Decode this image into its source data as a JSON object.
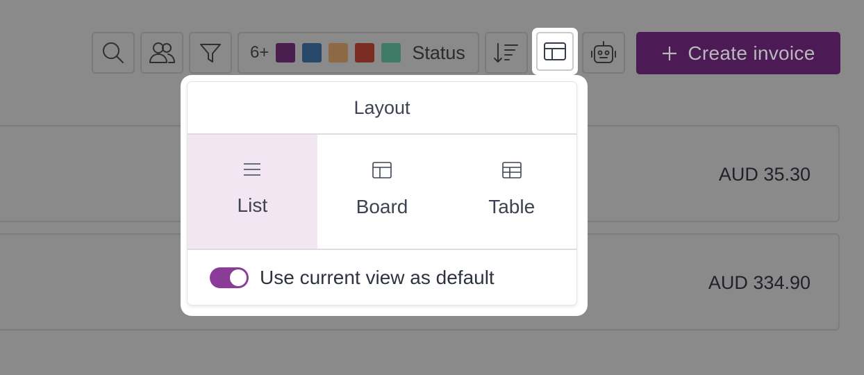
{
  "toolbar": {
    "search_icon": "search-icon",
    "people_icon": "people-icon",
    "filter_icon": "filter-icon",
    "status_filter": {
      "count": "6+",
      "colors": [
        "#4a1f4f",
        "#28496a",
        "#8d6a45",
        "#7c2d23",
        "#3f7a67"
      ],
      "label": "Status"
    },
    "sort_icon": "sort-icon",
    "layout_icon": "layout-icon",
    "robot_icon": "robot-icon",
    "create_button": {
      "label": "Create invoice",
      "icon": "plus-icon"
    }
  },
  "rows": [
    {
      "amount": "AUD 35.30"
    },
    {
      "amount": "AUD 334.90"
    }
  ],
  "layout_popover": {
    "title": "Layout",
    "options": [
      {
        "label": "List",
        "icon": "list-icon",
        "selected": true
      },
      {
        "label": "Board",
        "icon": "board-icon",
        "selected": false
      },
      {
        "label": "Table",
        "icon": "table-icon",
        "selected": false
      }
    ],
    "default_toggle": {
      "label": "Use current view as default",
      "on": true
    }
  },
  "colors": {
    "brand_purple": "#4c1a55",
    "toggle_on": "#8b3c99",
    "selected_option_bg": "#f2e6f3",
    "overlay_gray": "#8a8a8a"
  }
}
